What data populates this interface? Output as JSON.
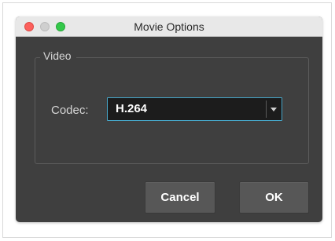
{
  "window": {
    "title": "Movie Options",
    "controls": [
      "close",
      "minimize",
      "maximize"
    ]
  },
  "video_group": {
    "title": "Video",
    "codec": {
      "label": "Codec:",
      "selected_value": "H.264",
      "dropdown_icon": "chevron-down-icon"
    }
  },
  "buttons": {
    "cancel_label": "Cancel",
    "ok_label": "OK"
  },
  "colors": {
    "window_background": "#3f3f3f",
    "titlebar_background": "#e8e8e8",
    "select_border_accent": "#46a6c8",
    "close_button": "#fc605c",
    "minimize_button": "#cfcfcf",
    "maximize_button": "#34c84a"
  }
}
